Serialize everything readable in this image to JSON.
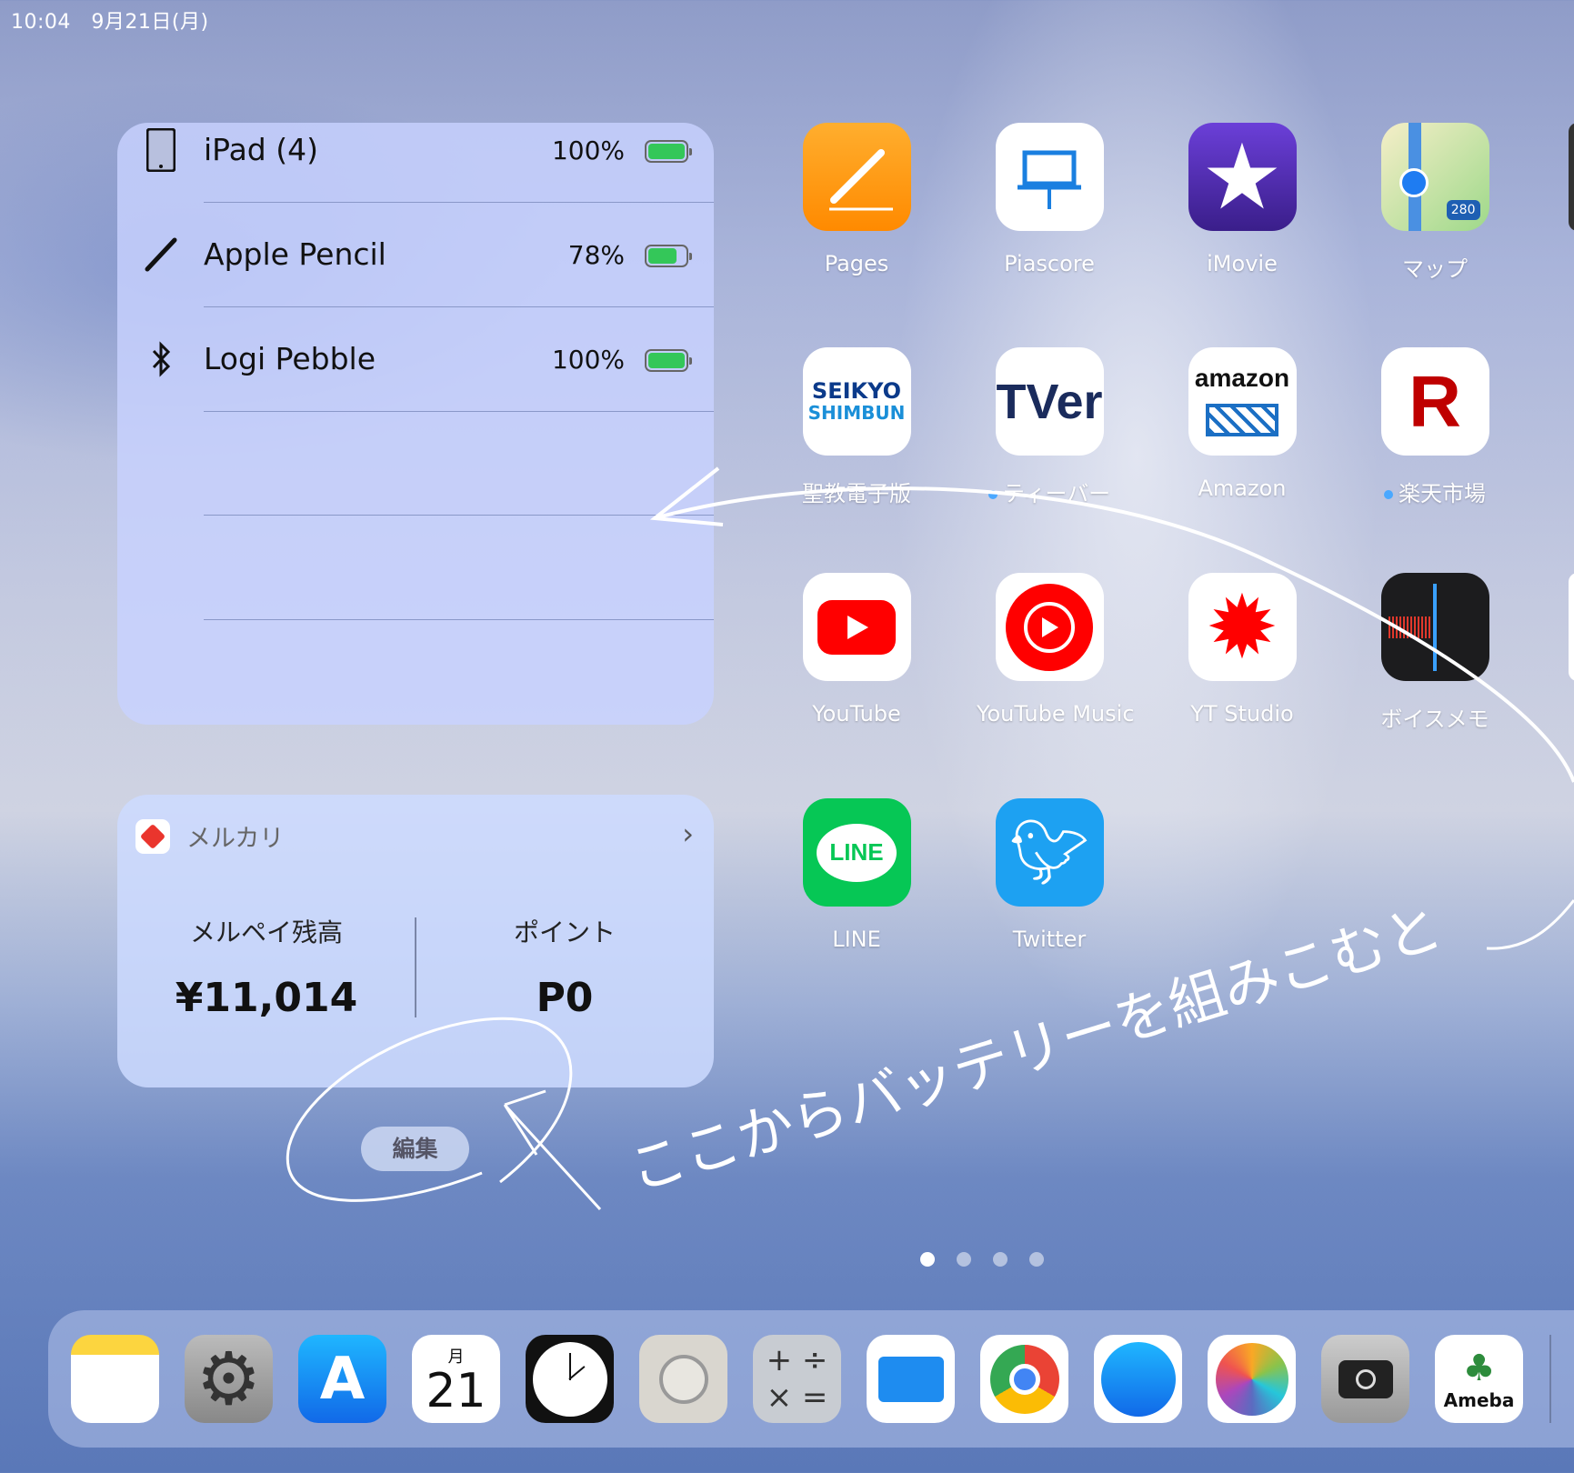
{
  "status_bar": {
    "time": "10:04",
    "date": "9月21日(月)"
  },
  "battery_widget": {
    "devices": [
      {
        "name": "iPad (4)",
        "percent_label": "100%",
        "level": 100,
        "icon": "ipad-icon"
      },
      {
        "name": "Apple Pencil",
        "percent_label": "78%",
        "level": 78,
        "icon": "pencil-icon"
      },
      {
        "name": "Logi Pebble",
        "percent_label": "100%",
        "level": 100,
        "icon": "bluetooth-icon"
      }
    ],
    "battery_color": "#34c759"
  },
  "mercari_widget": {
    "title": "メルカリ",
    "balance_label": "メルペイ残高",
    "balance_value": "¥11,014",
    "points_label": "ポイント",
    "points_value": "P0"
  },
  "edit_button": "編集",
  "apps": [
    {
      "label": "Pages",
      "icon": "pages-icon"
    },
    {
      "label": "Piascore",
      "icon": "piascore-icon"
    },
    {
      "label": "iMovie",
      "icon": "imovie-icon"
    },
    {
      "label": "マップ",
      "icon": "maps-icon"
    },
    {
      "label": "聖教電子版",
      "icon": "seikyo-icon",
      "logo_text": "SEIKYO SHIMBUN"
    },
    {
      "label": "ティーバー",
      "icon": "tver-icon",
      "new": true,
      "logo_text": "TVer"
    },
    {
      "label": "Amazon",
      "icon": "amazon-icon",
      "logo_text": "amazon"
    },
    {
      "label": "楽天市場",
      "icon": "rakuten-icon",
      "new": true,
      "logo_text": "R"
    },
    {
      "label": "YouTube",
      "icon": "youtube-icon"
    },
    {
      "label": "YouTube Music",
      "icon": "youtube-music-icon"
    },
    {
      "label": "YT Studio",
      "icon": "yt-studio-icon"
    },
    {
      "label": "ボイスメモ",
      "icon": "voice-memos-icon"
    },
    {
      "label": "LINE",
      "icon": "line-icon",
      "logo_text": "LINE"
    },
    {
      "label": "Twitter",
      "icon": "twitter-icon"
    }
  ],
  "page_indicator": {
    "pages": 4,
    "current": 1
  },
  "dock": [
    {
      "icon": "notes-icon"
    },
    {
      "icon": "settings-icon"
    },
    {
      "icon": "app-store-icon"
    },
    {
      "icon": "calendar-icon",
      "month": "月",
      "day": "21"
    },
    {
      "icon": "clock-icon"
    },
    {
      "icon": "contacts-icon"
    },
    {
      "icon": "calculator-icon"
    },
    {
      "icon": "files-icon"
    },
    {
      "icon": "chrome-icon"
    },
    {
      "icon": "safari-icon"
    },
    {
      "icon": "photos-icon"
    },
    {
      "icon": "camera-icon"
    },
    {
      "icon": "ameba-icon",
      "logo_text": "Ameba"
    }
  ],
  "annotation": {
    "text": "ここからバッテリーを組みこむと"
  }
}
